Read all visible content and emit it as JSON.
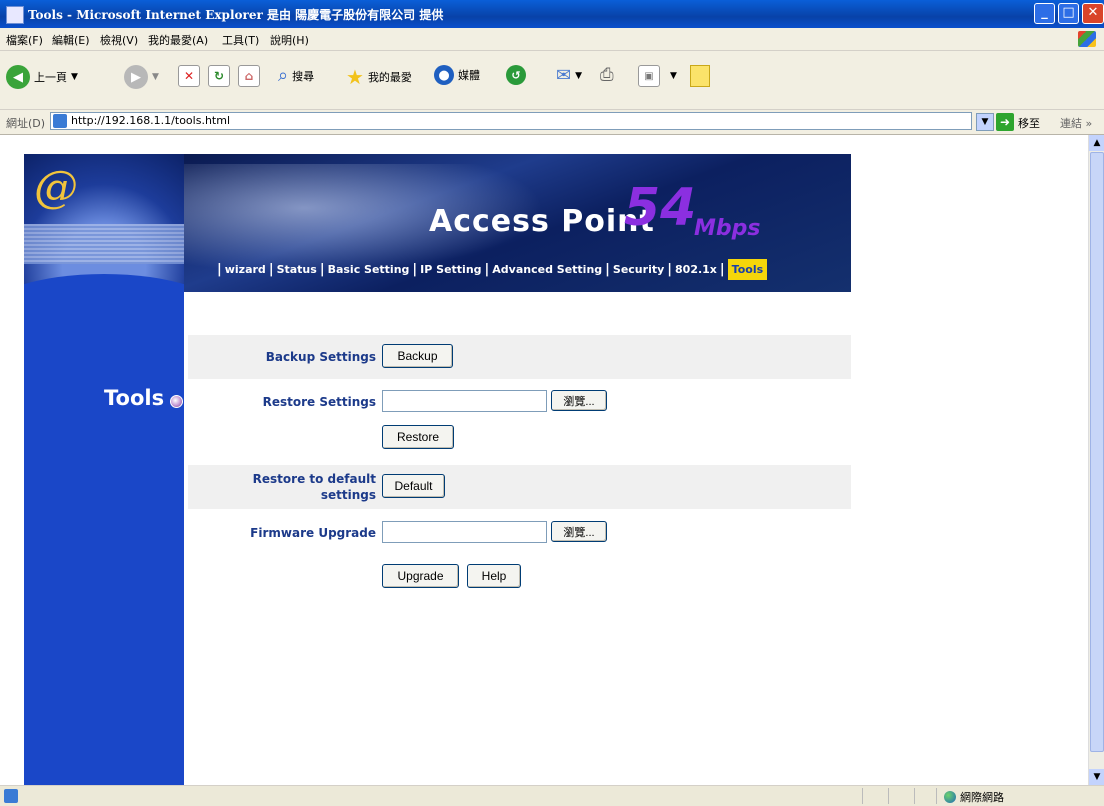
{
  "window": {
    "title": "Tools - Microsoft Internet Explorer 是由 陽慶電子股份有限公司 提供"
  },
  "menu": {
    "items": [
      "檔案(F)",
      "編輯(E)",
      "檢視(V)",
      "我的最愛(A)",
      "工具(T)",
      "說明(H)"
    ]
  },
  "toolbar": {
    "back_label": "上一頁",
    "search_label": "搜尋",
    "favorites_label": "我的最愛",
    "media_label": "媒體"
  },
  "address": {
    "label": "網址(D)",
    "url": "http://192.168.1.1/tools.html",
    "go_label": "移至",
    "links_label": "連結 »"
  },
  "banner": {
    "title": "Access Point",
    "speed": "54",
    "unit": "Mbps"
  },
  "nav": {
    "items": [
      "wizard",
      "Status",
      "Basic Setting",
      "IP Setting",
      "Advanced Setting",
      "Security",
      "802.1x",
      "Tools"
    ],
    "active": "Tools"
  },
  "side": {
    "section_title": "Tools"
  },
  "form": {
    "backup_label": "Backup Settings",
    "backup_button": "Backup",
    "restore_label": "Restore Settings",
    "restore_file_value": "",
    "browse_button_1": "瀏覽...",
    "restore_button": "Restore",
    "default_label_line1": "Restore to default",
    "default_label_line2": "settings",
    "default_button": "Default",
    "firmware_label": "Firmware Upgrade",
    "firmware_file_value": "",
    "browse_button_2": "瀏覽...",
    "upgrade_button": "Upgrade",
    "help_button": "Help"
  },
  "status": {
    "zone": "網際網路"
  }
}
